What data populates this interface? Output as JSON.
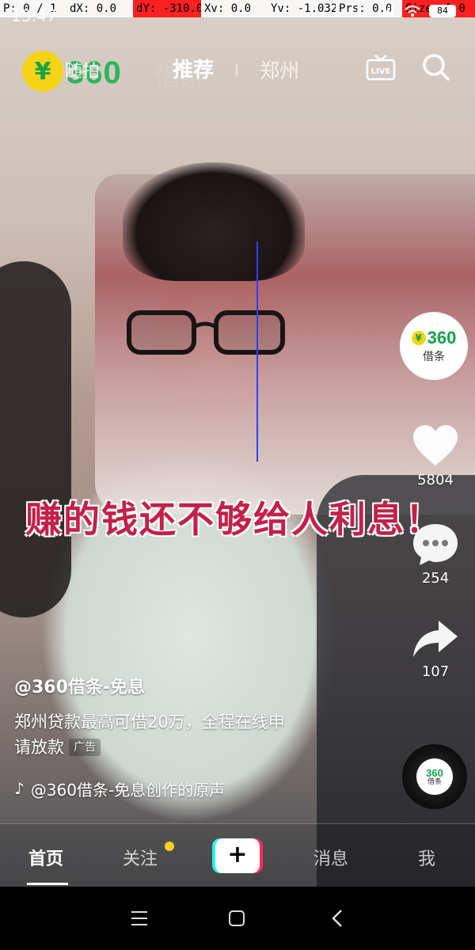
{
  "debug": {
    "p": "P: 0 / 1",
    "dx": "dX: 0.0",
    "dy": "dY: -310.0",
    "xv": "Xv: 0.0",
    "yv": "Yv: -1.032",
    "prs": "Prs: 0.0",
    "size": "Size: 1.0"
  },
  "status": {
    "time": "13:47",
    "battery": "84"
  },
  "top": {
    "logo_letter": "¥",
    "logo_text": "360",
    "logo_cn": "借条",
    "tab_random": "随拍",
    "tab_recommend": "推荐",
    "tab_city": "郑州",
    "live_label": "LIVE"
  },
  "caption": "赚的钱还不够给人利息！",
  "sidebar": {
    "brand_num": "360",
    "brand_cn": "借条",
    "likes": "5804",
    "comments": "254",
    "shares": "107"
  },
  "post": {
    "author": "@360借条-免息",
    "desc_line1": "郑州贷款最高可借20万，全程在线申",
    "desc_line2": "请放款",
    "ad_tag": "广告",
    "music": "@360借条-免息创作的原声"
  },
  "bottom_nav": {
    "home": "首页",
    "follow": "关注",
    "plus": "+",
    "messages": "消息",
    "me": "我"
  },
  "colors": {
    "brand_green": "#14a24b",
    "brand_yellow": "#f5d417",
    "caption_red": "#c3204a",
    "notif_dot": "#ffd21e"
  }
}
